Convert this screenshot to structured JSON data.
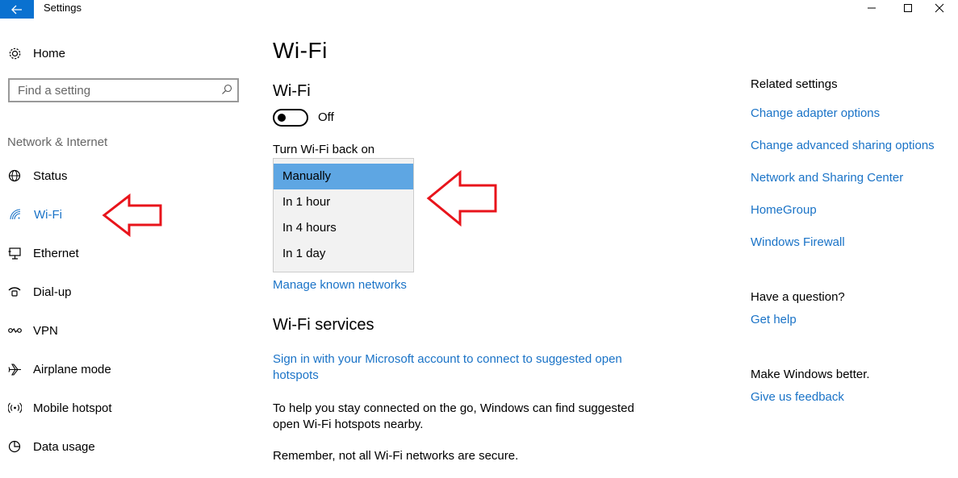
{
  "app": {
    "title": "Settings"
  },
  "sidebar": {
    "home_label": "Home",
    "search_placeholder": "Find a setting",
    "section_label": "Network & Internet",
    "items": [
      {
        "label": "Status",
        "icon": "globe-icon"
      },
      {
        "label": "Wi-Fi",
        "icon": "wifi-icon",
        "active": true
      },
      {
        "label": "Ethernet",
        "icon": "ethernet-icon"
      },
      {
        "label": "Dial-up",
        "icon": "dialup-icon"
      },
      {
        "label": "VPN",
        "icon": "vpn-icon"
      },
      {
        "label": "Airplane mode",
        "icon": "airplane-icon"
      },
      {
        "label": "Mobile hotspot",
        "icon": "hotspot-icon"
      },
      {
        "label": "Data usage",
        "icon": "data-usage-icon"
      }
    ]
  },
  "main": {
    "page_title": "Wi-Fi",
    "wifi_heading": "Wi-Fi",
    "toggle_state": "Off",
    "turn_back_label": "Turn Wi-Fi back on",
    "dropdown_options": [
      "Manually",
      "In 1 hour",
      "In 4 hours",
      "In 1 day"
    ],
    "dropdown_selected": "Manually",
    "manage_link": "Manage known networks",
    "services_heading": "Wi-Fi services",
    "signin_link": "Sign in with your Microsoft account to connect to suggested open hotspots",
    "help_text": "To help you stay connected on the go, Windows can find suggested open Wi-Fi hotspots nearby.",
    "remember_text": "Remember, not all Wi-Fi networks are secure."
  },
  "related": {
    "heading": "Related settings",
    "links": [
      "Change adapter options",
      "Change advanced sharing options",
      "Network and Sharing Center",
      "HomeGroup",
      "Windows Firewall"
    ],
    "question_heading": "Have a question?",
    "help_link": "Get help",
    "better_heading": "Make Windows better.",
    "feedback_link": "Give us feedback"
  },
  "colors": {
    "accent": "#1a73c7",
    "selected_option": "#5ea6e3",
    "back_button": "#0a71d0",
    "annotation_arrow": "#e8141b"
  }
}
